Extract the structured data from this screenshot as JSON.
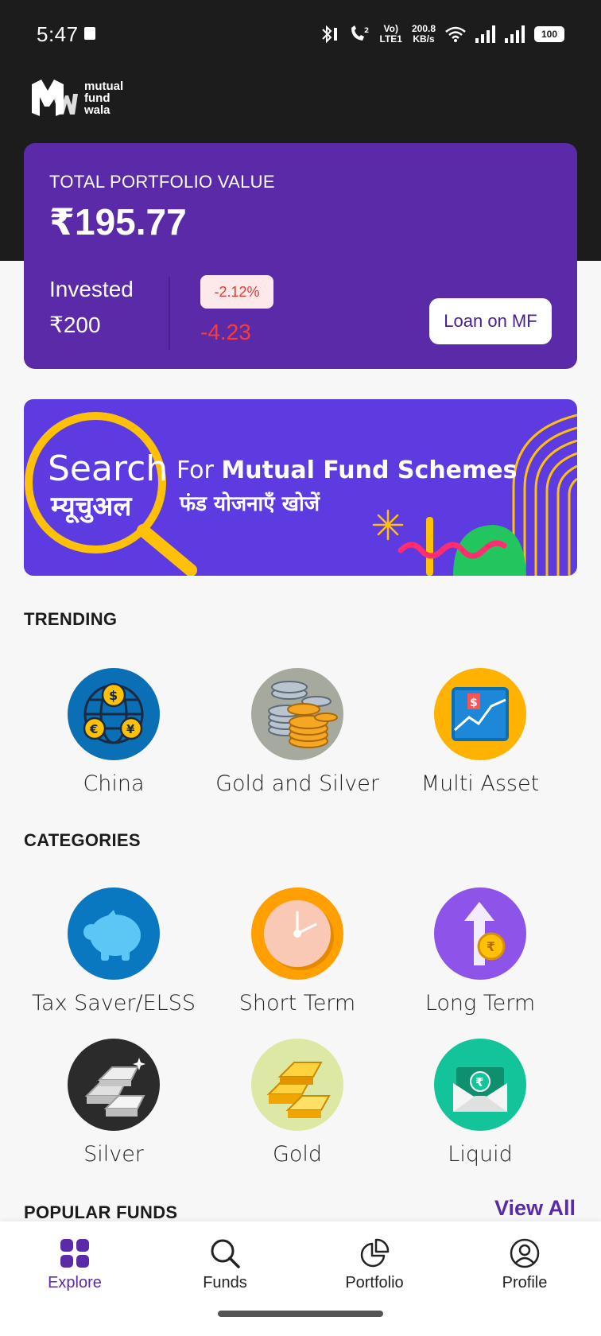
{
  "status_bar": {
    "time": "5:47",
    "network_label_top": "Vo)",
    "network_label_bottom": "LTE1",
    "speed_value": "200.8",
    "speed_unit": "KB/s",
    "battery": "100"
  },
  "app": {
    "logo_text_line1": "mutual",
    "logo_text_line2": "fund",
    "logo_text_line3": "wala"
  },
  "portfolio": {
    "label": "TOTAL PORTFOLIO VALUE",
    "value": "₹195.77",
    "invested_label": "Invested",
    "invested_value": "₹200",
    "change_percent": "-2.12%",
    "change_value": "-4.23",
    "loan_button": "Loan on MF"
  },
  "banner": {
    "search_word": "Search",
    "search_hindi": "म्यूचुअल",
    "line1_prefix": "For ",
    "line1_bold": "Mutual Fund Schemes",
    "line2": "फंड योजनाएँ खोजें"
  },
  "trending": {
    "title": "TRENDING",
    "items": [
      {
        "label": "China",
        "icon": "globe-currency-icon",
        "color": "#0a6fb5"
      },
      {
        "label": "Gold and Silver",
        "icon": "coins-icon",
        "color": "#a6aa9e"
      },
      {
        "label": "Multi Asset",
        "icon": "growth-chart-icon",
        "color": "#ffb300"
      }
    ]
  },
  "categories": {
    "title": "CATEGORIES",
    "items": [
      {
        "label": "Tax Saver/ELSS",
        "icon": "piggy-bank-icon",
        "color": "#0a78c0"
      },
      {
        "label": "Short Term",
        "icon": "clock-icon",
        "color": "#ffa000"
      },
      {
        "label": "Long Term",
        "icon": "arrow-up-coin-icon",
        "color": "#8e54e9"
      },
      {
        "label": "Silver",
        "icon": "silver-bars-icon",
        "color": "#2b2b2b"
      },
      {
        "label": "Gold",
        "icon": "gold-bars-icon",
        "color": "#dce8a4"
      },
      {
        "label": "Liquid",
        "icon": "cash-envelope-icon",
        "color": "#13c39a"
      }
    ]
  },
  "popular_funds": {
    "title": "POPULAR FUNDS",
    "view_all": "View All"
  },
  "nav": {
    "items": [
      {
        "label": "Explore",
        "icon": "grid-icon",
        "active": true
      },
      {
        "label": "Funds",
        "icon": "search-icon",
        "active": false
      },
      {
        "label": "Portfolio",
        "icon": "pie-chart-icon",
        "active": false
      },
      {
        "label": "Profile",
        "icon": "user-icon",
        "active": false
      }
    ]
  },
  "colors": {
    "brand_purple": "#5b2aa8",
    "banner_purple": "#5e3be0",
    "negative_red": "#ff3b30"
  }
}
